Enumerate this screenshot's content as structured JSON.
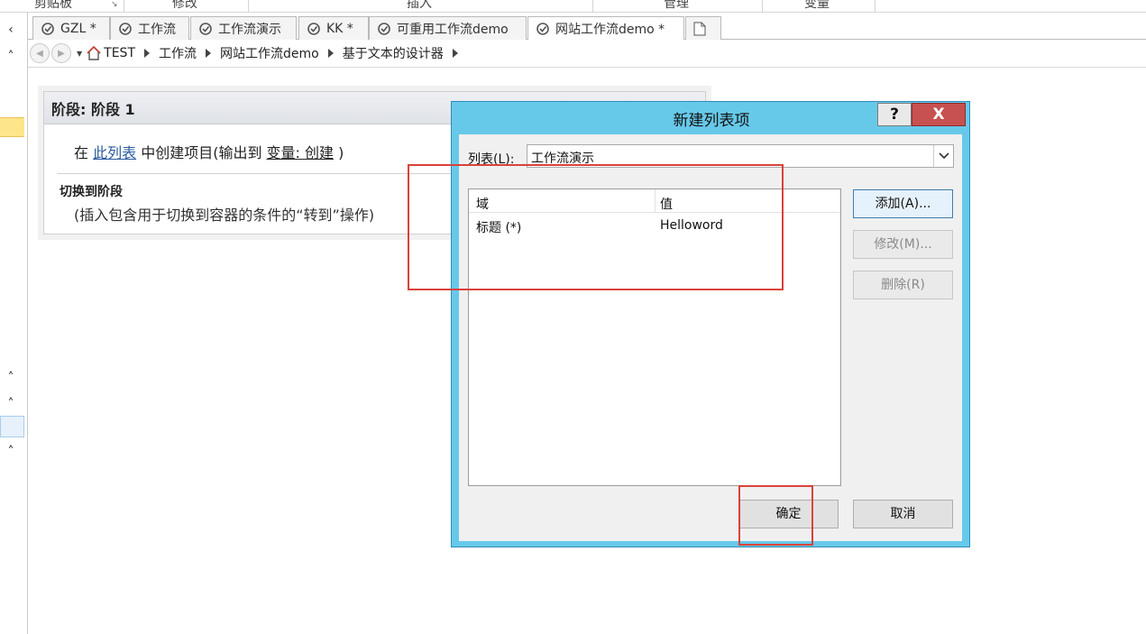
{
  "ribbon": {
    "groups": [
      "剪贴板",
      "修改",
      "插入",
      "管理",
      "变量"
    ]
  },
  "tabs": [
    {
      "label": "GZL *",
      "active": false
    },
    {
      "label": "工作流",
      "active": false
    },
    {
      "label": "工作流演示",
      "active": false
    },
    {
      "label": "KK *",
      "active": false
    },
    {
      "label": "可重用工作流demo",
      "active": false
    },
    {
      "label": "网站工作流demo *",
      "active": true
    }
  ],
  "breadcrumb": [
    "TEST",
    "工作流",
    "网站工作流demo",
    "基于文本的设计器"
  ],
  "stage": {
    "title": "阶段: 阶段 1",
    "action_prefix": "在 ",
    "action_link": "此列表",
    "action_middle": " 中创建项目(输出到 ",
    "action_var": "变量: 创建",
    "action_suffix": " )",
    "transition_title": "切换到阶段",
    "transition_hint": "(插入包含用于切换到容器的条件的“转到”操作)"
  },
  "dialog": {
    "title": "新建列表项",
    "help_label": "?",
    "close_label": "X",
    "list_label": "列表(L):",
    "list_value": "工作流演示",
    "grid": {
      "columns": [
        "域",
        "值"
      ],
      "rows": [
        {
          "field": "标题 (*)",
          "value": "Helloword"
        }
      ]
    },
    "buttons": {
      "add": "添加(A)...",
      "modify": "修改(M)...",
      "delete": "删除(R)",
      "ok": "确定",
      "cancel": "取消"
    }
  },
  "colors": {
    "dialog_frame": "#67c9ea",
    "close_button": "#c75050",
    "annotation_red": "#d9423a",
    "link": "#2b5aa0"
  }
}
